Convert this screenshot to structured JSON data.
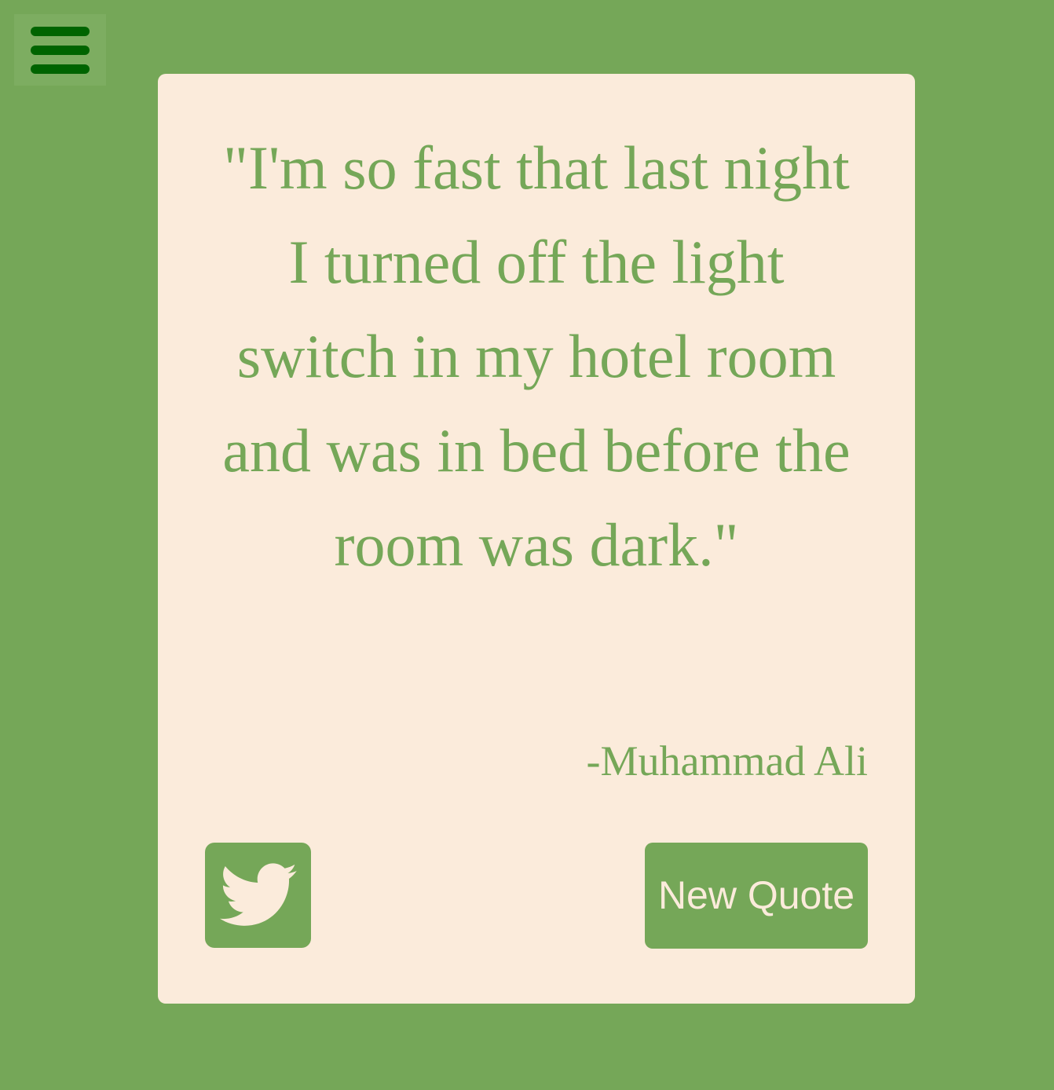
{
  "theme": {
    "page_background": "#75a758",
    "menu_button_background": "#7dad61",
    "menu_bar_color": "#006400",
    "card_background": "#fbebdb",
    "accent": "#75a758",
    "button_text": "#fbebdb"
  },
  "menu": {
    "icon": "hamburger-menu-icon"
  },
  "quote": {
    "text": "\"I'm so fast that last night I turned off the light switch in my hotel room and was in bed before the room was dark.\"",
    "author": "-Muhammad Ali"
  },
  "actions": {
    "tweet_icon": "twitter-bird-icon",
    "new_quote_label": "New Quote"
  }
}
